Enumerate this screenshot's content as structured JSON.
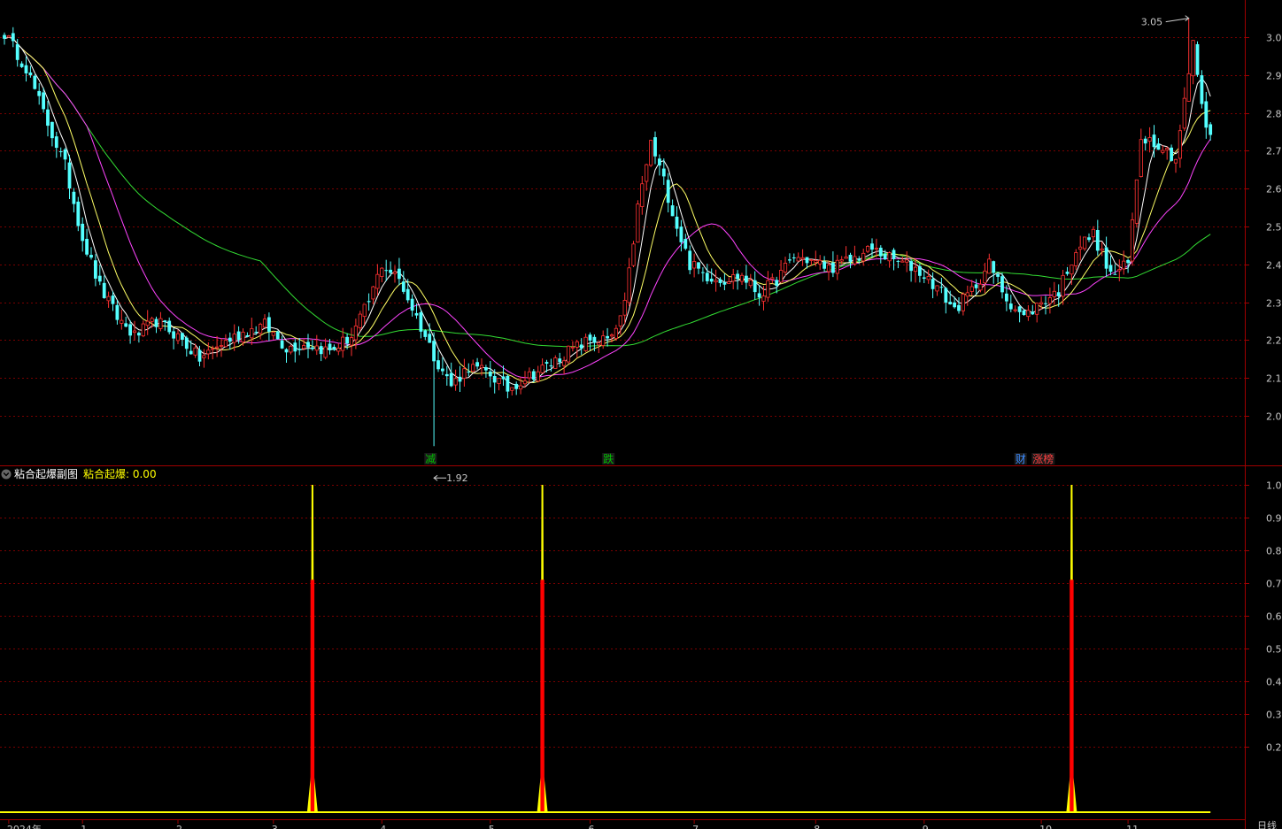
{
  "chart_data": [
    {
      "type": "candlestick",
      "ylim": [
        1.92,
        3.1
      ],
      "y_ticks": [
        "3.00",
        "2.90",
        "2.80",
        "2.70",
        "2.60",
        "2.50",
        "2.40",
        "2.30",
        "2.20",
        "2.10",
        "2.00"
      ],
      "y_tick_values": [
        3.0,
        2.9,
        2.8,
        2.7,
        2.6,
        2.5,
        2.4,
        2.3,
        2.2,
        2.1,
        2.0
      ],
      "high_label": "3.05",
      "high_value": 3.05,
      "low_label": "1.92",
      "low_value": 1.92,
      "markers": [
        {
          "text": "减",
          "color": "#00c000",
          "index": 97
        },
        {
          "text": "跌",
          "color": "#00c000",
          "index": 138
        },
        {
          "text": "财",
          "color": "#3b8bff",
          "index": 233
        },
        {
          "text": "涨榜",
          "color": "#ff4040",
          "index": 237
        }
      ],
      "price_anchors": [
        [
          0,
          3.01
        ],
        [
          5,
          2.92
        ],
        [
          9,
          2.8
        ],
        [
          14,
          2.66
        ],
        [
          18,
          2.47
        ],
        [
          22,
          2.34
        ],
        [
          26,
          2.26
        ],
        [
          30,
          2.21
        ],
        [
          35,
          2.25
        ],
        [
          40,
          2.21
        ],
        [
          45,
          2.15
        ],
        [
          50,
          2.19
        ],
        [
          55,
          2.22
        ],
        [
          60,
          2.24
        ],
        [
          65,
          2.18
        ],
        [
          70,
          2.19
        ],
        [
          75,
          2.17
        ],
        [
          80,
          2.21
        ],
        [
          84,
          2.3
        ],
        [
          87,
          2.4
        ],
        [
          91,
          2.36
        ],
        [
          95,
          2.26
        ],
        [
          99,
          2.16
        ],
        [
          103,
          2.08
        ],
        [
          107,
          2.13
        ],
        [
          112,
          2.11
        ],
        [
          116,
          2.07
        ],
        [
          120,
          2.1
        ],
        [
          125,
          2.13
        ],
        [
          130,
          2.17
        ],
        [
          135,
          2.2
        ],
        [
          140,
          2.2
        ],
        [
          143,
          2.29
        ],
        [
          146,
          2.55
        ],
        [
          149,
          2.72
        ],
        [
          152,
          2.62
        ],
        [
          155,
          2.5
        ],
        [
          158,
          2.4
        ],
        [
          162,
          2.37
        ],
        [
          166,
          2.36
        ],
        [
          170,
          2.37
        ],
        [
          174,
          2.32
        ],
        [
          178,
          2.36
        ],
        [
          182,
          2.42
        ],
        [
          186,
          2.41
        ],
        [
          190,
          2.39
        ],
        [
          195,
          2.41
        ],
        [
          200,
          2.44
        ],
        [
          205,
          2.41
        ],
        [
          210,
          2.39
        ],
        [
          215,
          2.34
        ],
        [
          219,
          2.28
        ],
        [
          223,
          2.33
        ],
        [
          227,
          2.4
        ],
        [
          231,
          2.31
        ],
        [
          235,
          2.26
        ],
        [
          239,
          2.3
        ],
        [
          243,
          2.33
        ],
        [
          247,
          2.44
        ],
        [
          251,
          2.48
        ],
        [
          255,
          2.37
        ],
        [
          259,
          2.4
        ],
        [
          262,
          2.74
        ],
        [
          266,
          2.72
        ],
        [
          270,
          2.68
        ],
        [
          274,
          2.98
        ],
        [
          277,
          2.75
        ]
      ]
    },
    {
      "type": "line",
      "title": "粘合起爆副图",
      "series": [
        {
          "name": "粘合起爆",
          "values": [
            0.0
          ]
        }
      ],
      "value_text": ": 0.00",
      "ylim": [
        0,
        1.05
      ],
      "y_ticks": [
        "1.00",
        "0.90",
        "0.80",
        "0.70",
        "0.60",
        "0.50",
        "0.40",
        "0.30",
        "0.20"
      ],
      "y_tick_values": [
        1.0,
        0.9,
        0.8,
        0.7,
        0.6,
        0.5,
        0.4,
        0.3,
        0.2
      ],
      "spike_indices": [
        71,
        124,
        246
      ],
      "spike_values": [
        1.0,
        1.0,
        1.0
      ],
      "x_ticks": [
        {
          "label": "2024年",
          "index": 1
        },
        {
          "label": "1",
          "index": 18
        },
        {
          "label": "2",
          "index": 40
        },
        {
          "label": "3",
          "index": 62
        },
        {
          "label": "4",
          "index": 87
        },
        {
          "label": "5",
          "index": 112
        },
        {
          "label": "6",
          "index": 135
        },
        {
          "label": "7",
          "index": 159
        },
        {
          "label": "8",
          "index": 187
        },
        {
          "label": "9",
          "index": 212
        },
        {
          "label": "10",
          "index": 239
        },
        {
          "label": "11",
          "index": 259
        }
      ],
      "period_label": "日线"
    }
  ],
  "colors": {
    "up": "#ff3232",
    "down": "#54ffff",
    "ma5": "#ffffff",
    "ma10": "#ffff66",
    "ma20": "#ff44ff",
    "ma60": "#33dd33",
    "grid": "#7a0000",
    "axis": "#a00000",
    "spike_outer": "#ffff00",
    "spike_inner": "#ff0000",
    "title": "#ffffff",
    "series_name": "#ffff00"
  }
}
